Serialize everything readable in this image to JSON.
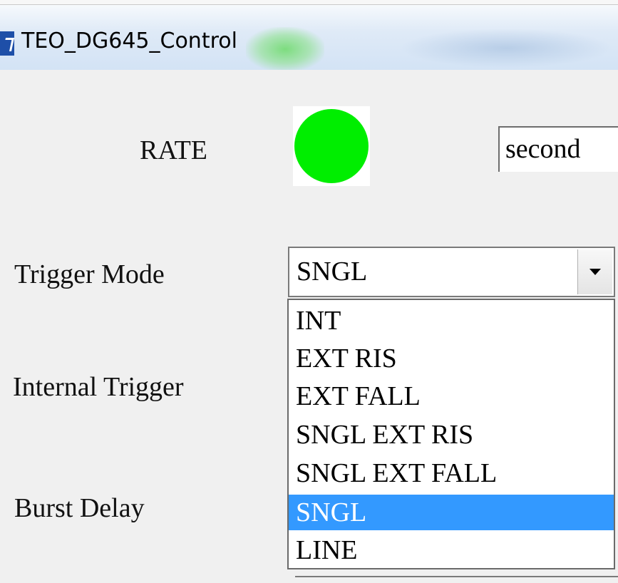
{
  "window": {
    "title": "TEO_DG645_Control",
    "icon": "app-icon"
  },
  "rate": {
    "label": "RATE",
    "led_color": "#00ee00",
    "unit_value": "second"
  },
  "trigger_mode": {
    "label": "Trigger Mode",
    "selected": "SNGL",
    "options": [
      "INT",
      "EXT RIS",
      "EXT FALL",
      "SNGL EXT RIS",
      "SNGL EXT FALL",
      "SNGL",
      "LINE"
    ],
    "selected_index": 5,
    "highlight_color": "#3399ff"
  },
  "internal_trigger": {
    "label": "Internal Trigger"
  },
  "burst_delay": {
    "label": "Burst Delay"
  }
}
